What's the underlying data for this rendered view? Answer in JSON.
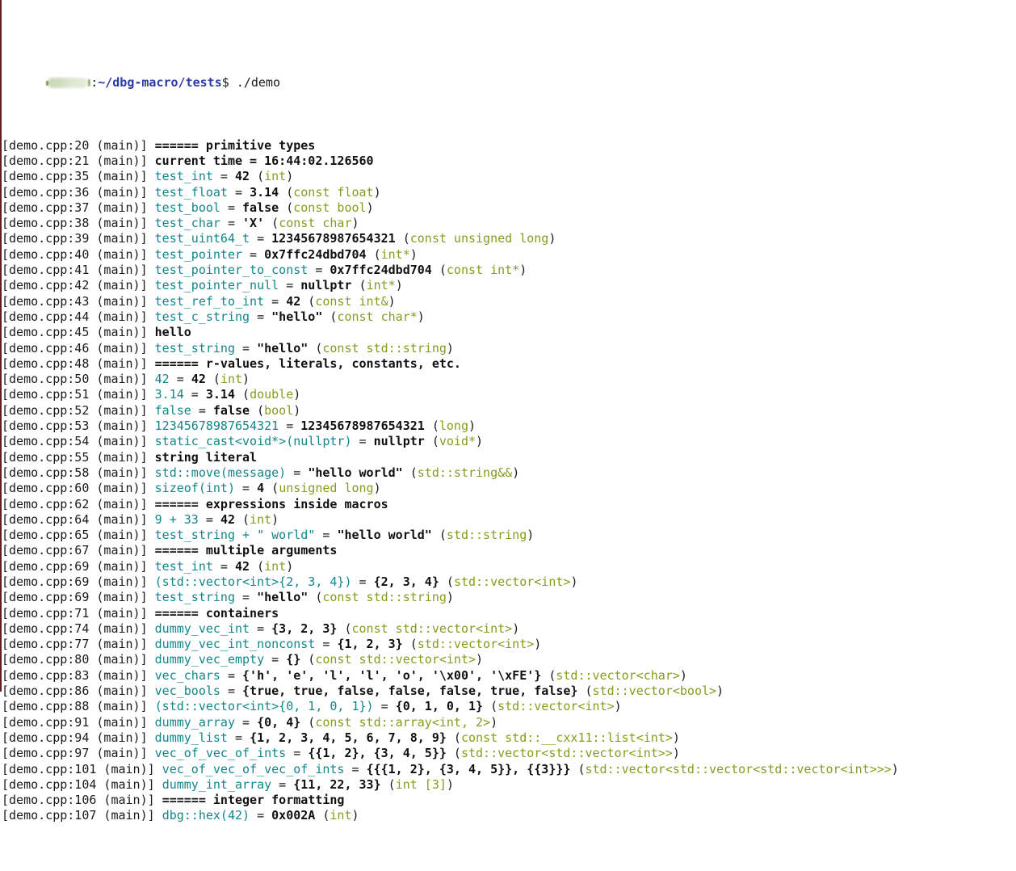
{
  "window": {
    "title": "Terminal — ./demo",
    "background_color": "#ffffff",
    "edge_stripe_color": "#5a2222"
  },
  "colors": {
    "default_text": "#1a1a1a",
    "expression_teal": "#12868b",
    "type_olive": "#8a9a1e",
    "value_bold": "#101010",
    "prompt_path_blue": "#2b38a8",
    "redaction_blob": "#d3e0c0"
  },
  "prompt": {
    "user_host": "",
    "user_host_redacted": true,
    "separator": ":",
    "path": "~/dbg-macro/tests",
    "sigil": "$",
    "command": " ./demo"
  },
  "output_lines": [
    {
      "loc": "[demo.cpp:20 (main)] ",
      "kind": "message",
      "message": "====== primitive types"
    },
    {
      "loc": "[demo.cpp:21 (main)] ",
      "kind": "message",
      "message": "current time = 16:44:02.126560"
    },
    {
      "loc": "[demo.cpp:35 (main)] ",
      "kind": "value",
      "expr": "test_int",
      "value": "42",
      "type": "int"
    },
    {
      "loc": "[demo.cpp:36 (main)] ",
      "kind": "value",
      "expr": "test_float",
      "value": "3.14",
      "type": "const float"
    },
    {
      "loc": "[demo.cpp:37 (main)] ",
      "kind": "value",
      "expr": "test_bool",
      "value": "false",
      "type": "const bool"
    },
    {
      "loc": "[demo.cpp:38 (main)] ",
      "kind": "value",
      "expr": "test_char",
      "value": "'X'",
      "type": "const char"
    },
    {
      "loc": "[demo.cpp:39 (main)] ",
      "kind": "value",
      "expr": "test_uint64_t",
      "value": "12345678987654321",
      "type": "const unsigned long"
    },
    {
      "loc": "[demo.cpp:40 (main)] ",
      "kind": "value",
      "expr": "test_pointer",
      "value": "0x7ffc24dbd704",
      "type": "int*"
    },
    {
      "loc": "[demo.cpp:41 (main)] ",
      "kind": "value",
      "expr": "test_pointer_to_const",
      "value": "0x7ffc24dbd704",
      "type": "const int*"
    },
    {
      "loc": "[demo.cpp:42 (main)] ",
      "kind": "value",
      "expr": "test_pointer_null",
      "value": "nullptr",
      "type": "int*"
    },
    {
      "loc": "[demo.cpp:43 (main)] ",
      "kind": "value",
      "expr": "test_ref_to_int",
      "value": "42",
      "type": "const int&"
    },
    {
      "loc": "[demo.cpp:44 (main)] ",
      "kind": "value",
      "expr": "test_c_string",
      "value": "\"hello\"",
      "type": "const char*"
    },
    {
      "loc": "[demo.cpp:45 (main)] ",
      "kind": "message",
      "message": "hello"
    },
    {
      "loc": "[demo.cpp:46 (main)] ",
      "kind": "value",
      "expr": "test_string",
      "value": "\"hello\"",
      "type": "const std::string"
    },
    {
      "loc": "[demo.cpp:48 (main)] ",
      "kind": "message",
      "message": "====== r-values, literals, constants, etc."
    },
    {
      "loc": "[demo.cpp:50 (main)] ",
      "kind": "value",
      "expr": "42",
      "value": "42",
      "type": "int"
    },
    {
      "loc": "[demo.cpp:51 (main)] ",
      "kind": "value",
      "expr": "3.14",
      "value": "3.14",
      "type": "double"
    },
    {
      "loc": "[demo.cpp:52 (main)] ",
      "kind": "value",
      "expr": "false",
      "value": "false",
      "type": "bool"
    },
    {
      "loc": "[demo.cpp:53 (main)] ",
      "kind": "value",
      "expr": "12345678987654321",
      "value": "12345678987654321",
      "type": "long"
    },
    {
      "loc": "[demo.cpp:54 (main)] ",
      "kind": "value",
      "expr": "static_cast<void*>(nullptr)",
      "value": "nullptr",
      "type": "void*"
    },
    {
      "loc": "[demo.cpp:55 (main)] ",
      "kind": "message",
      "message": "string literal"
    },
    {
      "loc": "[demo.cpp:58 (main)] ",
      "kind": "value",
      "expr": "std::move(message)",
      "value": "\"hello world\"",
      "type": "std::string&&"
    },
    {
      "loc": "[demo.cpp:60 (main)] ",
      "kind": "value",
      "expr": "sizeof(int)",
      "value": "4",
      "type": "unsigned long"
    },
    {
      "loc": "[demo.cpp:62 (main)] ",
      "kind": "message",
      "message": "====== expressions inside macros"
    },
    {
      "loc": "[demo.cpp:64 (main)] ",
      "kind": "value",
      "expr": "9 + 33",
      "value": "42",
      "type": "int"
    },
    {
      "loc": "[demo.cpp:65 (main)] ",
      "kind": "value",
      "expr": "test_string + \" world\"",
      "value": "\"hello world\"",
      "type": "std::string"
    },
    {
      "loc": "[demo.cpp:67 (main)] ",
      "kind": "message",
      "message": "====== multiple arguments"
    },
    {
      "loc": "[demo.cpp:69 (main)] ",
      "kind": "value",
      "expr": "test_int",
      "value": "42",
      "type": "int"
    },
    {
      "loc": "[demo.cpp:69 (main)] ",
      "kind": "value",
      "expr": "(std::vector<int>{2, 3, 4})",
      "value": "{2, 3, 4}",
      "type": "std::vector<int>"
    },
    {
      "loc": "[demo.cpp:69 (main)] ",
      "kind": "value",
      "expr": "test_string",
      "value": "\"hello\"",
      "type": "const std::string"
    },
    {
      "loc": "[demo.cpp:71 (main)] ",
      "kind": "message",
      "message": "====== containers"
    },
    {
      "loc": "[demo.cpp:74 (main)] ",
      "kind": "value",
      "expr": "dummy_vec_int",
      "value": "{3, 2, 3}",
      "type": "const std::vector<int>"
    },
    {
      "loc": "[demo.cpp:77 (main)] ",
      "kind": "value",
      "expr": "dummy_vec_int_nonconst",
      "value": "{1, 2, 3}",
      "type": "std::vector<int>"
    },
    {
      "loc": "[demo.cpp:80 (main)] ",
      "kind": "value",
      "expr": "dummy_vec_empty",
      "value": "{}",
      "type": "const std::vector<int>"
    },
    {
      "loc": "[demo.cpp:83 (main)] ",
      "kind": "value",
      "expr": "vec_chars",
      "value": "{'h', 'e', 'l', 'l', 'o', '\\x00', '\\xFE'}",
      "type": "std::vector<char>"
    },
    {
      "loc": "[demo.cpp:86 (main)] ",
      "kind": "value",
      "expr": "vec_bools",
      "value": "{true, true, false, false, false, true, false}",
      "type": "std::vector<bool>"
    },
    {
      "loc": "[demo.cpp:88 (main)] ",
      "kind": "value",
      "expr": "(std::vector<int>{0, 1, 0, 1})",
      "value": "{0, 1, 0, 1}",
      "type": "std::vector<int>"
    },
    {
      "loc": "[demo.cpp:91 (main)] ",
      "kind": "value",
      "expr": "dummy_array",
      "value": "{0, 4}",
      "type": "const std::array<int, 2>"
    },
    {
      "loc": "[demo.cpp:94 (main)] ",
      "kind": "value",
      "expr": "dummy_list",
      "value": "{1, 2, 3, 4, 5, 6, 7, 8, 9}",
      "type": "const std::__cxx11::list<int>"
    },
    {
      "loc": "[demo.cpp:97 (main)] ",
      "kind": "value",
      "expr": "vec_of_vec_of_ints",
      "value": "{{1, 2}, {3, 4, 5}}",
      "type": "std::vector<std::vector<int>>"
    },
    {
      "loc": "[demo.cpp:101 (main)] ",
      "kind": "value",
      "expr": "vec_of_vec_of_vec_of_ints",
      "value": "{{{1, 2}, {3, 4, 5}}, {{3}}}",
      "type": "std::vector<std::vector<std::vector<int>>>"
    },
    {
      "loc": "[demo.cpp:104 (main)] ",
      "kind": "value",
      "expr": "dummy_int_array",
      "value": "{11, 22, 33}",
      "type": "int [3]"
    },
    {
      "loc": "[demo.cpp:106 (main)] ",
      "kind": "message",
      "message": "====== integer formatting"
    },
    {
      "loc": "[demo.cpp:107 (main)] ",
      "kind": "value",
      "expr": "dbg::hex(42)",
      "value": "0x002A",
      "type": "int"
    }
  ]
}
